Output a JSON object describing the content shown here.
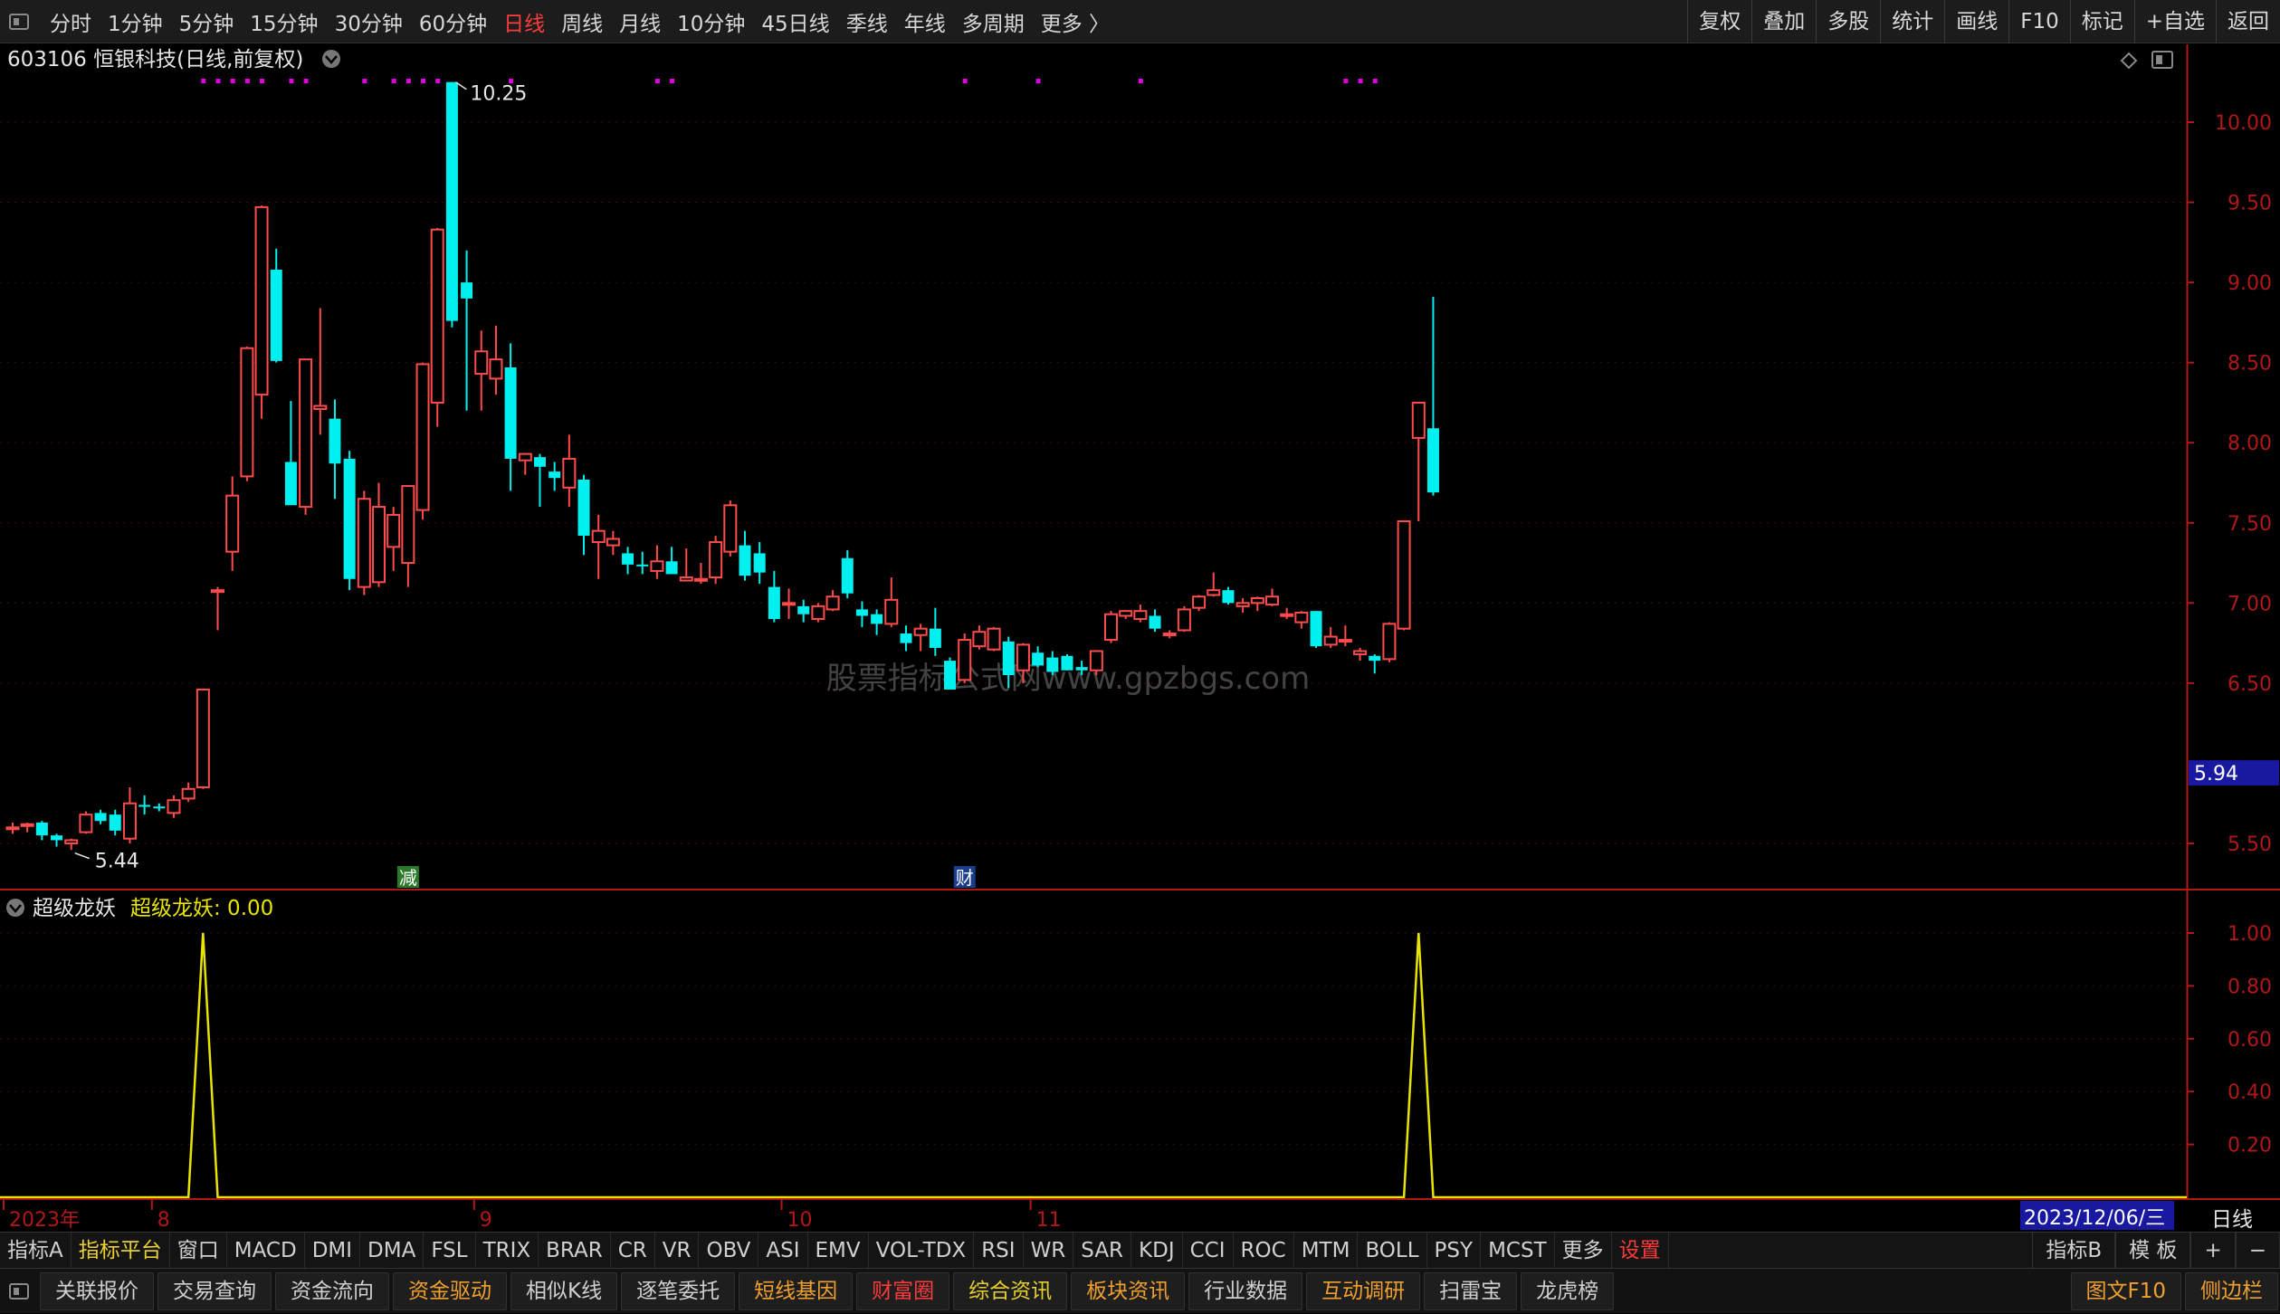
{
  "toolbar": {
    "periods": [
      "分时",
      "1分钟",
      "5分钟",
      "15分钟",
      "30分钟",
      "60分钟",
      "日线",
      "周线",
      "月线",
      "10分钟",
      "45日线",
      "季线",
      "年线",
      "多周期",
      "更多 〉"
    ],
    "active_period": "日线",
    "right": [
      "复权",
      "叠加",
      "多股",
      "统计",
      "画线",
      "F10",
      "标记",
      "+自选",
      "返回"
    ]
  },
  "main": {
    "title": "603106 恒银科技(日线,前复权)",
    "price_labels": [
      "10.00",
      "9.50",
      "9.00",
      "8.50",
      "8.00",
      "7.50",
      "7.00",
      "6.50",
      "5.50"
    ],
    "current_price": "5.94",
    "high_label": "10.25",
    "low_label": "5.44",
    "watermark": "股票指标公式网www.gpzbgs.com",
    "event_left": "减",
    "event_right": "财",
    "colors": {
      "up": "#ff4b4b",
      "down": "#00f0f0",
      "bg": "#000000",
      "axis": "#b01818"
    }
  },
  "indicator": {
    "name": "超级龙妖",
    "value_label": "超级龙妖: 0.00",
    "scale_labels": [
      "1.00",
      "0.80",
      "0.60",
      "0.40",
      "0.20"
    ],
    "color": "#e8e400"
  },
  "date_axis": {
    "labels": [
      "2023年",
      "8",
      "9",
      "10",
      "11"
    ],
    "cursor_date": "2023/12/06/三",
    "period_label": "日线"
  },
  "indicator_tabs": [
    "指标A",
    "指标平台",
    "窗口",
    "MACD",
    "DMI",
    "DMA",
    "FSL",
    "TRIX",
    "BRAR",
    "CR",
    "VR",
    "OBV",
    "ASI",
    "EMV",
    "VOL-TDX",
    "RSI",
    "WR",
    "SAR",
    "KDJ",
    "CCI",
    "ROC",
    "MTM",
    "BOLL",
    "PSY",
    "MCST",
    "更多",
    "设置"
  ],
  "indicator_tabs_right": [
    "指标B",
    "模 板",
    "+",
    "−"
  ],
  "bottom_buttons": [
    "关联报价",
    "交易查询",
    "资金流向",
    "资金驱动",
    "相似K线",
    "逐笔委托",
    "短线基因",
    "财富圈",
    "综合资讯",
    "板块资讯",
    "行业数据",
    "互动调研",
    "扫雷宝",
    "龙虎榜"
  ],
  "bottom_right": [
    "图文F10",
    "侧边栏"
  ],
  "chart_data": {
    "type": "candlestick",
    "candles": [
      [
        5.6,
        5.63,
        5.56,
        5.6
      ],
      [
        5.62,
        5.63,
        5.57,
        5.62
      ],
      [
        5.63,
        5.64,
        5.52,
        5.55
      ],
      [
        5.55,
        5.56,
        5.48,
        5.52
      ],
      [
        5.5,
        5.53,
        5.46,
        5.52
      ],
      [
        5.57,
        5.7,
        5.56,
        5.68
      ],
      [
        5.69,
        5.71,
        5.62,
        5.64
      ],
      [
        5.68,
        5.71,
        5.55,
        5.58
      ],
      [
        5.53,
        5.85,
        5.5,
        5.75
      ],
      [
        5.74,
        5.8,
        5.68,
        5.73
      ],
      [
        5.73,
        5.75,
        5.7,
        5.72
      ],
      [
        5.69,
        5.8,
        5.66,
        5.77
      ],
      [
        5.78,
        5.88,
        5.76,
        5.84
      ],
      [
        5.85,
        6.46,
        5.84,
        6.46
      ],
      [
        7.08,
        7.1,
        6.83,
        7.08
      ],
      [
        7.32,
        7.79,
        7.2,
        7.67
      ],
      [
        7.79,
        8.6,
        7.76,
        8.59
      ],
      [
        8.3,
        9.48,
        8.15,
        9.47
      ],
      [
        9.08,
        9.21,
        8.5,
        8.51
      ],
      [
        7.88,
        8.26,
        7.69,
        7.61
      ],
      [
        7.6,
        8.51,
        7.55,
        8.52
      ],
      [
        8.21,
        8.84,
        8.05,
        8.23
      ],
      [
        8.15,
        8.27,
        7.65,
        7.87
      ],
      [
        7.9,
        7.95,
        7.08,
        7.15
      ],
      [
        7.1,
        7.7,
        7.05,
        7.65
      ],
      [
        7.13,
        7.75,
        7.1,
        7.6
      ],
      [
        7.35,
        7.6,
        7.2,
        7.55
      ],
      [
        7.25,
        7.73,
        7.1,
        7.73
      ],
      [
        7.58,
        8.5,
        7.52,
        8.49
      ],
      [
        8.25,
        9.34,
        8.1,
        9.33
      ],
      [
        10.25,
        10.25,
        8.72,
        8.76
      ],
      [
        9.0,
        9.2,
        8.2,
        8.9
      ],
      [
        8.43,
        8.7,
        8.2,
        8.57
      ],
      [
        8.4,
        8.73,
        8.3,
        8.52
      ],
      [
        8.47,
        8.62,
        7.7,
        7.9
      ],
      [
        7.89,
        7.93,
        7.8,
        7.93
      ],
      [
        7.91,
        7.93,
        7.6,
        7.85
      ],
      [
        7.82,
        7.88,
        7.7,
        7.78
      ],
      [
        7.72,
        8.05,
        7.6,
        7.9
      ],
      [
        7.77,
        7.8,
        7.3,
        7.42
      ],
      [
        7.38,
        7.55,
        7.15,
        7.45
      ],
      [
        7.36,
        7.45,
        7.3,
        7.4
      ],
      [
        7.31,
        7.35,
        7.18,
        7.24
      ],
      [
        7.24,
        7.32,
        7.18,
        7.23
      ],
      [
        7.2,
        7.36,
        7.15,
        7.26
      ],
      [
        7.26,
        7.35,
        7.18,
        7.18
      ],
      [
        7.14,
        7.34,
        7.14,
        7.16
      ],
      [
        7.15,
        7.25,
        7.12,
        7.15
      ],
      [
        7.16,
        7.42,
        7.12,
        7.38
      ],
      [
        7.32,
        7.64,
        7.29,
        7.61
      ],
      [
        7.36,
        7.45,
        7.14,
        7.17
      ],
      [
        7.31,
        7.38,
        7.12,
        7.19
      ],
      [
        7.1,
        7.2,
        6.88,
        6.9
      ],
      [
        6.99,
        7.09,
        6.9,
        7.0
      ],
      [
        6.98,
        7.02,
        6.88,
        6.93
      ],
      [
        6.9,
        7.0,
        6.88,
        6.98
      ],
      [
        6.96,
        7.08,
        6.95,
        7.04
      ],
      [
        7.28,
        7.33,
        7.03,
        7.06
      ],
      [
        6.96,
        7.01,
        6.85,
        6.92
      ],
      [
        6.93,
        6.96,
        6.8,
        6.87
      ],
      [
        6.87,
        7.16,
        6.85,
        7.02
      ],
      [
        6.81,
        6.86,
        6.7,
        6.75
      ],
      [
        6.8,
        6.87,
        6.7,
        6.84
      ],
      [
        6.84,
        6.97,
        6.67,
        6.72
      ],
      [
        6.64,
        6.66,
        6.46,
        6.46
      ],
      [
        6.52,
        6.81,
        6.5,
        6.77
      ],
      [
        6.73,
        6.86,
        6.71,
        6.82
      ],
      [
        6.71,
        6.85,
        6.7,
        6.84
      ],
      [
        6.76,
        6.79,
        6.47,
        6.55
      ],
      [
        6.58,
        6.75,
        6.5,
        6.74
      ],
      [
        6.69,
        6.73,
        6.6,
        6.61
      ],
      [
        6.66,
        6.7,
        6.55,
        6.57
      ],
      [
        6.67,
        6.68,
        6.58,
        6.58
      ],
      [
        6.6,
        6.64,
        6.55,
        6.58
      ],
      [
        6.58,
        6.7,
        6.55,
        6.7
      ],
      [
        6.77,
        6.95,
        6.75,
        6.93
      ],
      [
        6.92,
        6.95,
        6.9,
        6.95
      ],
      [
        6.9,
        6.99,
        6.88,
        6.95
      ],
      [
        6.92,
        6.96,
        6.82,
        6.84
      ],
      [
        6.8,
        6.83,
        6.78,
        6.81
      ],
      [
        6.83,
        6.98,
        6.82,
        6.96
      ],
      [
        6.97,
        7.05,
        6.95,
        7.04
      ],
      [
        7.05,
        7.19,
        7.04,
        7.08
      ],
      [
        7.08,
        7.1,
        6.99,
        7.0
      ],
      [
        6.98,
        7.03,
        6.94,
        7.0
      ],
      [
        7.0,
        7.04,
        6.95,
        7.03
      ],
      [
        6.99,
        7.09,
        6.98,
        7.04
      ],
      [
        6.92,
        6.97,
        6.9,
        6.93
      ],
      [
        6.88,
        6.95,
        6.84,
        6.94
      ],
      [
        6.95,
        6.95,
        6.72,
        6.73
      ],
      [
        6.74,
        6.85,
        6.72,
        6.79
      ],
      [
        6.77,
        6.86,
        6.73,
        6.77
      ],
      [
        6.68,
        6.72,
        6.64,
        6.7
      ],
      [
        6.67,
        6.68,
        6.56,
        6.64
      ],
      [
        6.65,
        6.88,
        6.63,
        6.87
      ],
      [
        6.84,
        7.51,
        6.83,
        7.51
      ],
      [
        8.03,
        8.25,
        7.51,
        8.25
      ],
      [
        8.09,
        8.91,
        7.67,
        7.69
      ]
    ],
    "indicator": {
      "name": "超级龙妖",
      "values": [
        0,
        0,
        0,
        0,
        0,
        0,
        0,
        0,
        0,
        0,
        0,
        0,
        0,
        1,
        0,
        0,
        0,
        0,
        0,
        0,
        0,
        0,
        0,
        0,
        0,
        0,
        0,
        0,
        0,
        0,
        0,
        0,
        0,
        0,
        0,
        0,
        0,
        0,
        0,
        0,
        0,
        0,
        0,
        0,
        0,
        0,
        0,
        0,
        0,
        0,
        0,
        0,
        0,
        0,
        0,
        0,
        0,
        0,
        0,
        0,
        0,
        0,
        0,
        0,
        0,
        0,
        0,
        0,
        0,
        0,
        0,
        0,
        0,
        0,
        0,
        0,
        0,
        0,
        0,
        0,
        0,
        0,
        0,
        0,
        0,
        0,
        0,
        0,
        0,
        0,
        0,
        0,
        0,
        0,
        0,
        0,
        1,
        0,
        0
      ],
      "ylim": [
        0,
        1.0
      ]
    },
    "ylim": [
      5.3,
      10.35
    ]
  }
}
